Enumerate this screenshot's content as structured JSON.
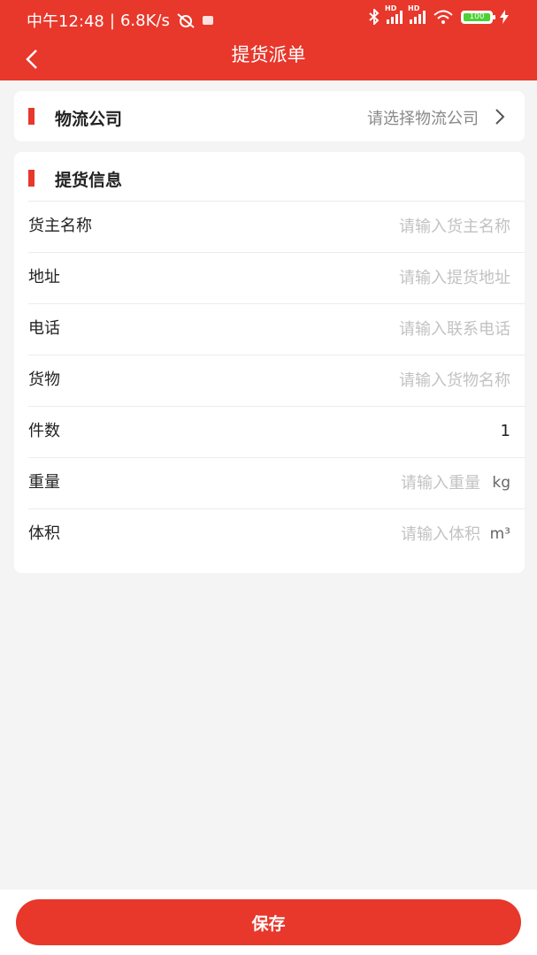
{
  "status_bar": {
    "time": "中午12:48",
    "net_speed": "6.8K/s",
    "hd_label": "HD",
    "battery_level": "100"
  },
  "nav": {
    "title": "提货派单"
  },
  "company": {
    "label": "物流公司",
    "placeholder": "请选择物流公司"
  },
  "pickup_info": {
    "title": "提货信息",
    "fields": [
      {
        "label": "货主名称",
        "placeholder": "请输入货主名称",
        "value": ""
      },
      {
        "label": "地址",
        "placeholder": "请输入提货地址",
        "value": ""
      },
      {
        "label": "电话",
        "placeholder": "请输入联系电话",
        "value": ""
      },
      {
        "label": "货物",
        "placeholder": "请输入货物名称",
        "value": ""
      },
      {
        "label": "件数",
        "value": "1"
      },
      {
        "label": "重量",
        "placeholder": "请输入重量",
        "unit": "kg",
        "value": ""
      },
      {
        "label": "体积",
        "placeholder": "请输入体积",
        "unit": "m³",
        "value": ""
      }
    ]
  },
  "footer": {
    "save_label": "保存"
  },
  "colors": {
    "primary": "#e8372b",
    "background": "#f4f4f4",
    "placeholder": "#c2c2c2"
  }
}
